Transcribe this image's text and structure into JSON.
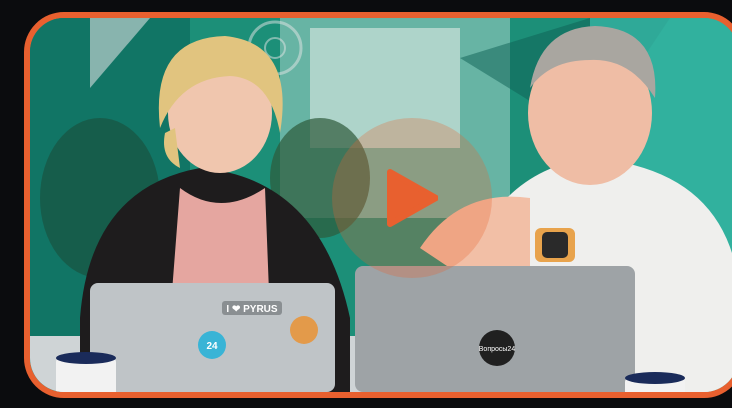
{
  "video": {
    "accent_color": "#e8602f",
    "play_icon": "play-icon",
    "laptop_left": {
      "badge_text": "24",
      "sticker_text": "I ❤ PYRUS"
    },
    "laptop_right": {
      "logo_text": "Вопросы24"
    }
  }
}
